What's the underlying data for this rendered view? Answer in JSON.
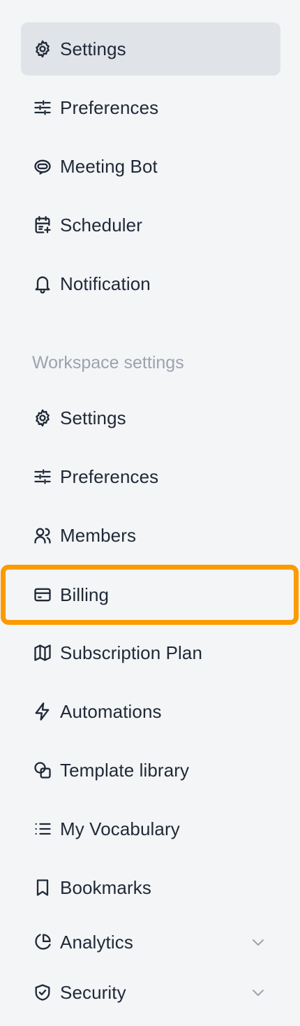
{
  "personal_nav": [
    {
      "label": "Settings",
      "icon": "gear-icon"
    },
    {
      "label": "Preferences",
      "icon": "sliders-icon"
    },
    {
      "label": "Meeting Bot",
      "icon": "bot-icon"
    },
    {
      "label": "Scheduler",
      "icon": "calendar-icon"
    },
    {
      "label": "Notification",
      "icon": "bell-icon"
    }
  ],
  "workspace_section": {
    "heading": "Workspace settings",
    "items": [
      {
        "label": "Settings",
        "icon": "gear-icon"
      },
      {
        "label": "Preferences",
        "icon": "sliders-icon"
      },
      {
        "label": "Members",
        "icon": "users-icon"
      },
      {
        "label": "Billing",
        "icon": "credit-card-icon"
      },
      {
        "label": "Subscription Plan",
        "icon": "map-icon"
      },
      {
        "label": "Automations",
        "icon": "lightning-icon"
      },
      {
        "label": "Template library",
        "icon": "shapes-icon"
      },
      {
        "label": "My Vocabulary",
        "icon": "list-icon"
      },
      {
        "label": "Bookmarks",
        "icon": "bookmark-icon"
      },
      {
        "label": "Analytics",
        "icon": "pie-chart-icon"
      },
      {
        "label": "Security",
        "icon": "shield-check-icon"
      }
    ]
  },
  "colors": {
    "background": "#f4f5f7",
    "active_background": "#e0e3e8",
    "highlight_outline": "#fb9b00",
    "text": "#1f2937",
    "muted_text": "#9ca3af"
  }
}
